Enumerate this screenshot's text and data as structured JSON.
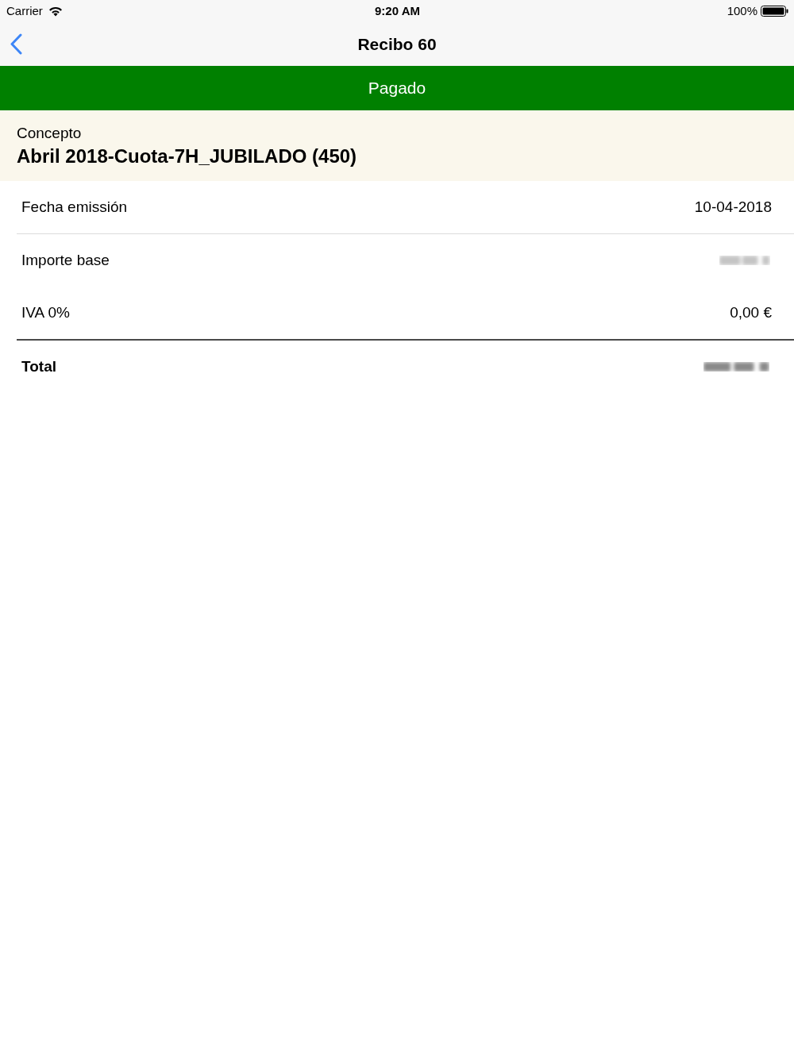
{
  "status_bar": {
    "carrier": "Carrier",
    "time": "9:20 AM",
    "battery": "100%"
  },
  "nav_bar": {
    "title": "Recibo 60"
  },
  "status_banner": {
    "label": "Pagado"
  },
  "concept": {
    "label": "Concepto",
    "value": "Abril 2018-Cuota-7H_JUBILADO (450)"
  },
  "sections": [
    {
      "rows": [
        {
          "label": "Fecha emissión",
          "value": "10-04-2018",
          "redacted": false
        }
      ]
    },
    {
      "rows": [
        {
          "label": "Importe base",
          "redacted": true
        },
        {
          "label": "IVA 0%",
          "value": "0,00 €",
          "redacted": false
        }
      ]
    }
  ],
  "total": {
    "label": "Total",
    "redacted": true
  }
}
